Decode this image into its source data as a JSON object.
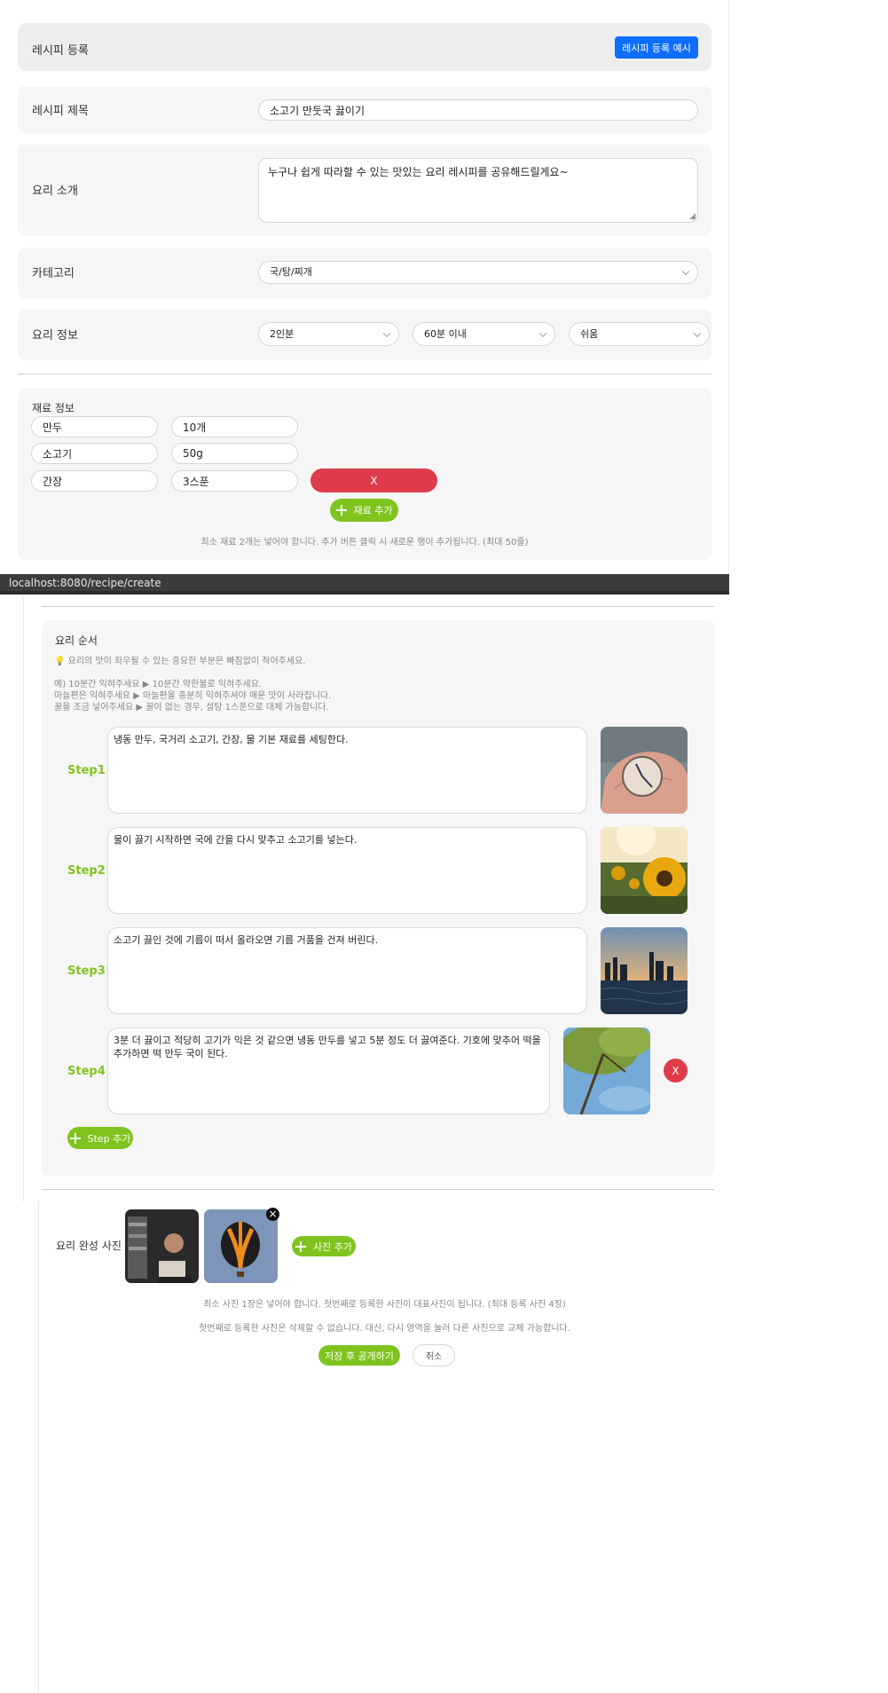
{
  "header": {
    "title": "레시피 등록",
    "example_button": "레시피 등록 예시"
  },
  "form": {
    "title_label": "레시피 제목",
    "title_value": "소고기 만둣국 끓이기",
    "intro_label": "요리 소개",
    "intro_value": "누구나 쉽게 따라할 수 있는 맛있는 요리 레시피를 공유해드릴게요~",
    "category_label": "카테고리",
    "category_value": "국/탕/찌개",
    "info_label": "요리 정보",
    "info_servings": "2인분",
    "info_time": "60분 이내",
    "info_difficulty": "쉬움"
  },
  "ingredients": {
    "label": "재료 정보",
    "items": [
      {
        "name": "만두",
        "amount": "10개"
      },
      {
        "name": "소고기",
        "amount": "50g"
      },
      {
        "name": "간장",
        "amount": "3스푼"
      }
    ],
    "remove_label": "X",
    "add_label": "재료 추가",
    "note": "최소 재료 2개는 넣어야 합니다. 추가 버튼 클릭 시 새로운 행이 추가됩니다. (최대 50줄)"
  },
  "status_bar": {
    "url": "localhost:8080/recipe/create"
  },
  "steps": {
    "label": "요리 순서",
    "tip_line1": "요리의 맛이 좌우될 수 있는 중요한 부분은 빠짐없이 적어주세요.",
    "tip_line2": "예) 10분간 익혀주세요 ▶ 10분간 약한불로 익혀주세요.",
    "tip_line3": "마늘편은 익혀주세요 ▶ 마늘편을 충분히 익혀주셔야 매운 맛이 사라집니다.",
    "tip_line4": "꿀을 조금 넣어주세요 ▶ 꿀이 없는 경우, 설탕 1스푼으로 대체 가능합니다.",
    "items": [
      {
        "label": "Step1",
        "text": "냉동 만두, 국거리 소고기, 간장, 물 기본 재료를 세팅한다.",
        "image": "clock-on-palm"
      },
      {
        "label": "Step2",
        "text": "물이 끓기 시작하면 국에 간을 다시 맞추고 소고기를 넣는다.",
        "image": "sunflowers"
      },
      {
        "label": "Step3",
        "text": "소고기 끓인 것에 기름이 떠서 올라오면 기름 거품을 건져 버린다.",
        "image": "city-skyline-water"
      },
      {
        "label": "Step4",
        "text": "3분 더 끓이고 적당히 고기가 익은 것 같으면 냉동 만두를 넣고 5분 정도 더 끓여준다. 기호에 맞추어 떡을 추가하면 떡 만두 국이 된다.",
        "image": "tree-sky"
      }
    ],
    "remove_label": "X",
    "add_label": "Step 추가"
  },
  "photos": {
    "label": "요리 완성 사진",
    "add_label": "사진 추가",
    "close_label": "×",
    "images": [
      "person-with-books",
      "hot-air-balloon"
    ],
    "note1": "최소 사진 1장은 넣어야 합니다. 첫번째로 등록한 사진이 대표사진이 됩니다. (최대 등록 사진 4장)",
    "note2": "첫번째로 등록한 사진은 삭제할 수 없습니다. 대신, 다시 영역을 눌러 다른 사진으로 교체 가능합니다."
  },
  "actions": {
    "save": "저장 후 공개하기",
    "cancel": "취소"
  },
  "colors": {
    "accent": "#7fc41e",
    "primary": "#0d6efd",
    "danger": "#de3b4b"
  }
}
